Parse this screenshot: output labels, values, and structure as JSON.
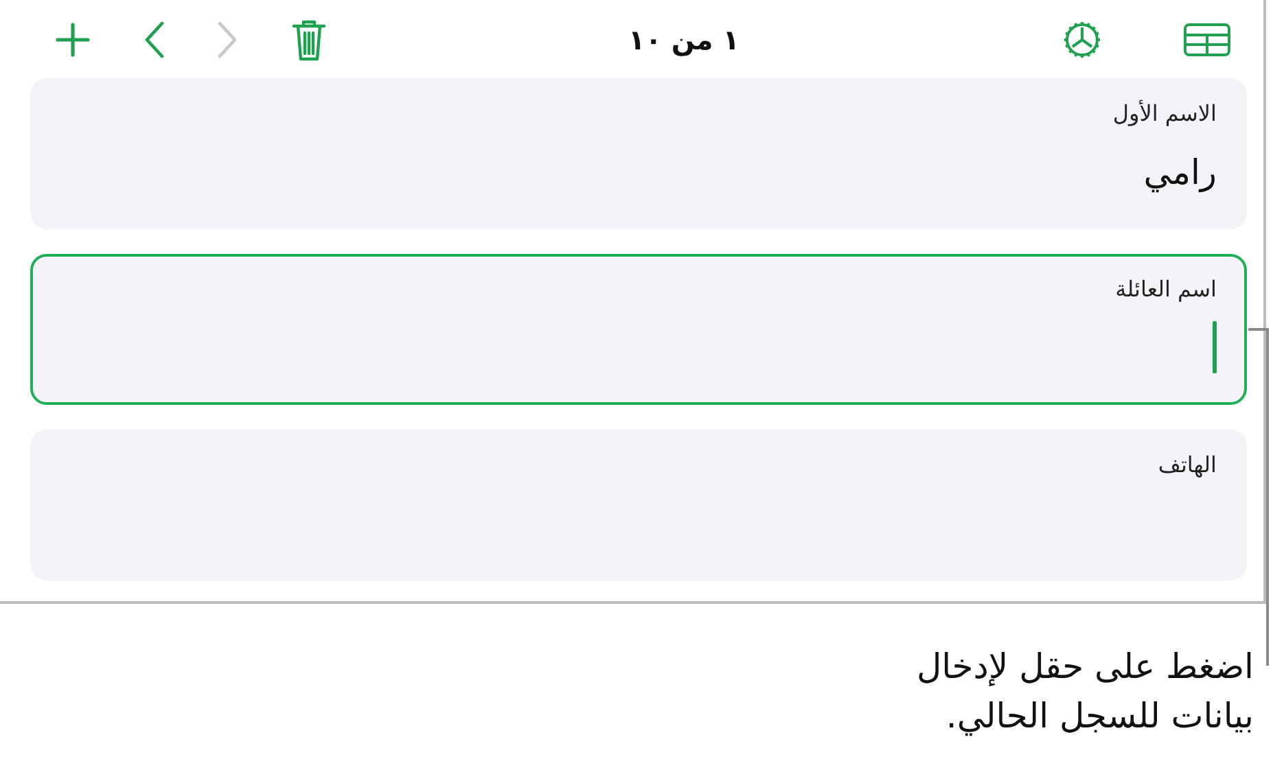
{
  "toolbar": {
    "title": "١ من ١٠",
    "buttons": [
      {
        "kind": "add",
        "disabled": false
      },
      {
        "kind": "back",
        "disabled": false
      },
      {
        "kind": "forward",
        "disabled": true
      },
      {
        "kind": "delete",
        "disabled": false
      },
      {
        "kind": "settings",
        "disabled": false
      },
      {
        "kind": "table",
        "disabled": false
      }
    ]
  },
  "fields": [
    {
      "label": "الاسم الأول",
      "value": "رامي",
      "focused": false
    },
    {
      "label": "اسم العائلة",
      "focused": true
    },
    {
      "label": "الهاتف",
      "focused": false
    }
  ],
  "callout": "اضغط على حقل لإدخال بيانات للسجل الحالي."
}
